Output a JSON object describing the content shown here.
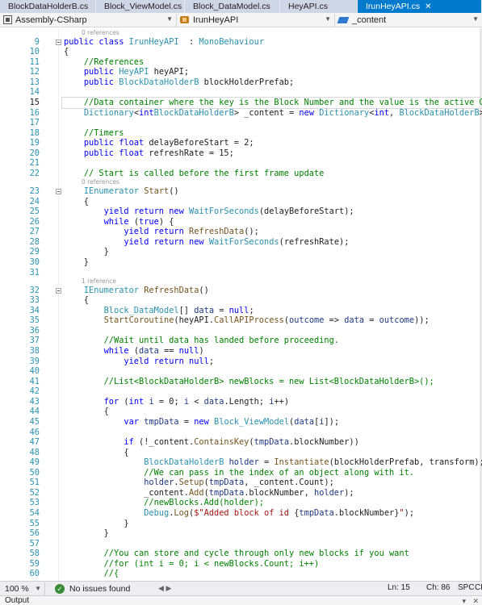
{
  "tabs": [
    {
      "label": "BlockDataHolderB.cs",
      "active": false
    },
    {
      "label": "Block_ViewModel.cs",
      "active": false
    },
    {
      "label": "Block_DataModel.cs",
      "active": false
    },
    {
      "label": "HeyAPI.cs",
      "active": false
    },
    {
      "label": "IrunHeyAPI.cs",
      "active": true
    }
  ],
  "nav": {
    "project": "Assembly-CSharp",
    "class_name": "IrunHeyAPI",
    "member": "_content"
  },
  "editor": {
    "current_line": 15,
    "lines": [
      {
        "n": "",
        "lens": "0 references"
      },
      {
        "n": "9",
        "fold": true,
        "tokens": [
          [
            "kw",
            "public "
          ],
          [
            "kw",
            "class "
          ],
          [
            "ty",
            "IrunHeyAPI"
          ],
          [
            "",
            "  : "
          ],
          [
            "ty",
            "MonoBehaviour"
          ]
        ]
      },
      {
        "n": "10",
        "tokens": [
          [
            "",
            "{"
          ]
        ]
      },
      {
        "n": "11",
        "tokens": [
          [
            "",
            "    "
          ],
          [
            "cm",
            "//References"
          ]
        ]
      },
      {
        "n": "12",
        "tokens": [
          [
            "",
            "    "
          ],
          [
            "kw",
            "public "
          ],
          [
            "ty",
            "HeyAPI"
          ],
          [
            "",
            " heyAPI;"
          ]
        ]
      },
      {
        "n": "13",
        "tokens": [
          [
            "",
            "    "
          ],
          [
            "kw",
            "public "
          ],
          [
            "ty",
            "BlockDataHolderB"
          ],
          [
            "",
            " blockHolderPrefab;"
          ]
        ]
      },
      {
        "n": "14",
        "tokens": []
      },
      {
        "n": "15",
        "tokens": [
          [
            "",
            "    "
          ],
          [
            "cm",
            "//Data container where the key is the Block Number and the value is the active GameObject"
          ]
        ]
      },
      {
        "n": "16",
        "tokens": [
          [
            "",
            "    "
          ],
          [
            "ty",
            "Dictionary"
          ],
          [
            "",
            "<"
          ],
          [
            "kw",
            "int"
          ],
          [
            ", ",
            ""
          ],
          [
            "ty",
            "BlockDataHolderB"
          ],
          [
            "",
            "> _content = "
          ],
          [
            "kw",
            "new "
          ],
          [
            "ty",
            "Dictionary"
          ],
          [
            "",
            "<"
          ],
          [
            "kw",
            "int"
          ],
          [
            "",
            ", "
          ],
          [
            "ty",
            "BlockDataHolderB"
          ],
          [
            "",
            ">();"
          ]
        ]
      },
      {
        "n": "17",
        "tokens": []
      },
      {
        "n": "18",
        "tokens": [
          [
            "",
            "    "
          ],
          [
            "cm",
            "//Timers"
          ]
        ]
      },
      {
        "n": "19",
        "tokens": [
          [
            "",
            "    "
          ],
          [
            "kw",
            "public "
          ],
          [
            "kw",
            "float "
          ],
          [
            "",
            "delayBeforeStart = 2;"
          ]
        ]
      },
      {
        "n": "20",
        "tokens": [
          [
            "",
            "    "
          ],
          [
            "kw",
            "public "
          ],
          [
            "kw",
            "float "
          ],
          [
            "",
            "refreshRate = 15;"
          ]
        ]
      },
      {
        "n": "21",
        "tokens": []
      },
      {
        "n": "22",
        "tokens": [
          [
            "",
            "    "
          ],
          [
            "cm",
            "// Start is called before the first frame update"
          ]
        ]
      },
      {
        "n": "",
        "lens": "0 references"
      },
      {
        "n": "23",
        "fold": true,
        "tokens": [
          [
            "",
            "    "
          ],
          [
            "ty",
            "IEnumerator"
          ],
          [
            "",
            " "
          ],
          [
            "mt",
            "Start"
          ],
          [
            "",
            "()"
          ]
        ]
      },
      {
        "n": "24",
        "tokens": [
          [
            "",
            "    {"
          ]
        ]
      },
      {
        "n": "25",
        "tokens": [
          [
            "",
            "        "
          ],
          [
            "kw",
            "yield "
          ],
          [
            "kw",
            "return "
          ],
          [
            "kw",
            "new "
          ],
          [
            "ty",
            "WaitForSeconds"
          ],
          [
            "",
            "(delayBeforeStart);"
          ]
        ]
      },
      {
        "n": "26",
        "tokens": [
          [
            "",
            "        "
          ],
          [
            "kw",
            "while "
          ],
          [
            "",
            "("
          ],
          [
            "kw",
            "true"
          ],
          [
            "",
            ") {"
          ]
        ]
      },
      {
        "n": "27",
        "tokens": [
          [
            "",
            "            "
          ],
          [
            "kw",
            "yield "
          ],
          [
            "kw",
            "return "
          ],
          [
            "mt",
            "RefreshData"
          ],
          [
            "",
            "();"
          ]
        ]
      },
      {
        "n": "28",
        "tokens": [
          [
            "",
            "            "
          ],
          [
            "kw",
            "yield "
          ],
          [
            "kw",
            "return "
          ],
          [
            "kw",
            "new "
          ],
          [
            "ty",
            "WaitForSeconds"
          ],
          [
            "",
            "(refreshRate);"
          ]
        ]
      },
      {
        "n": "29",
        "tokens": [
          [
            "",
            "        }"
          ]
        ]
      },
      {
        "n": "30",
        "tokens": [
          [
            "",
            "    }"
          ]
        ]
      },
      {
        "n": "31",
        "tokens": []
      },
      {
        "n": "",
        "lens": "1 reference"
      },
      {
        "n": "32",
        "fold": true,
        "tokens": [
          [
            "",
            "    "
          ],
          [
            "ty",
            "IEnumerator"
          ],
          [
            "",
            " "
          ],
          [
            "mt",
            "RefreshData"
          ],
          [
            "",
            "()"
          ]
        ]
      },
      {
        "n": "33",
        "tokens": [
          [
            "",
            "    {"
          ]
        ]
      },
      {
        "n": "34",
        "tokens": [
          [
            "",
            "        "
          ],
          [
            "ty",
            "Block_DataModel"
          ],
          [
            "",
            "[] "
          ],
          [
            "vl",
            "data"
          ],
          [
            "",
            " = "
          ],
          [
            "kw",
            "null"
          ],
          [
            "",
            ";"
          ]
        ]
      },
      {
        "n": "35",
        "tokens": [
          [
            "",
            "        "
          ],
          [
            "mt",
            "StartCoroutine"
          ],
          [
            "",
            "(heyAPI."
          ],
          [
            "mt",
            "CallAPIProcess"
          ],
          [
            "",
            "("
          ],
          [
            "vl",
            "outcome"
          ],
          [
            "",
            " => "
          ],
          [
            "vl",
            "data"
          ],
          [
            "",
            " = "
          ],
          [
            "vl",
            "outcome"
          ],
          [
            "",
            "));"
          ]
        ]
      },
      {
        "n": "36",
        "tokens": []
      },
      {
        "n": "37",
        "tokens": [
          [
            "",
            "        "
          ],
          [
            "cm",
            "//Wait until data has landed before proceeding."
          ]
        ]
      },
      {
        "n": "38",
        "tokens": [
          [
            "",
            "        "
          ],
          [
            "kw",
            "while "
          ],
          [
            "",
            "("
          ],
          [
            "vl",
            "data"
          ],
          [
            "",
            " == "
          ],
          [
            "kw",
            "null"
          ],
          [
            "",
            ")"
          ]
        ]
      },
      {
        "n": "39",
        "tokens": [
          [
            "",
            "            "
          ],
          [
            "kw",
            "yield "
          ],
          [
            "kw",
            "return "
          ],
          [
            "kw",
            "null"
          ],
          [
            "",
            ";"
          ]
        ]
      },
      {
        "n": "40",
        "tokens": []
      },
      {
        "n": "41",
        "tokens": [
          [
            "",
            "        "
          ],
          [
            "cm",
            "//List<BlockDataHolderB> newBlocks = new List<BlockDataHolderB>();"
          ]
        ]
      },
      {
        "n": "42",
        "tokens": []
      },
      {
        "n": "43",
        "tokens": [
          [
            "",
            "        "
          ],
          [
            "kw",
            "for "
          ],
          [
            "",
            "("
          ],
          [
            "kw",
            "int "
          ],
          [
            "vl",
            "i"
          ],
          [
            "",
            " = 0; "
          ],
          [
            "vl",
            "i"
          ],
          [
            "",
            " < "
          ],
          [
            "vl",
            "data"
          ],
          [
            "",
            ".Length; "
          ],
          [
            "vl",
            "i"
          ],
          [
            "",
            "++)"
          ]
        ]
      },
      {
        "n": "44",
        "tokens": [
          [
            "",
            "        {"
          ]
        ]
      },
      {
        "n": "45",
        "tokens": [
          [
            "",
            "            "
          ],
          [
            "kw",
            "var "
          ],
          [
            "vl",
            "tmpData"
          ],
          [
            "",
            " = "
          ],
          [
            "kw",
            "new "
          ],
          [
            "ty",
            "Block_ViewModel"
          ],
          [
            "",
            "("
          ],
          [
            "vl",
            "data"
          ],
          [
            "",
            "["
          ],
          [
            "vl",
            "i"
          ],
          [
            "",
            "]);"
          ]
        ]
      },
      {
        "n": "46",
        "tokens": []
      },
      {
        "n": "47",
        "tokens": [
          [
            "",
            "            "
          ],
          [
            "kw",
            "if "
          ],
          [
            "",
            "(!_content."
          ],
          [
            "mt",
            "ContainsKey"
          ],
          [
            "",
            "("
          ],
          [
            "vl",
            "tmpData"
          ],
          [
            "",
            ".blockNumber))"
          ]
        ]
      },
      {
        "n": "48",
        "tokens": [
          [
            "",
            "            {"
          ]
        ]
      },
      {
        "n": "49",
        "tokens": [
          [
            "",
            "                "
          ],
          [
            "ty",
            "BlockDataHolderB"
          ],
          [
            "",
            " "
          ],
          [
            "vl",
            "holder"
          ],
          [
            "",
            " = "
          ],
          [
            "mt",
            "Instantiate"
          ],
          [
            "",
            "(blockHolderPrefab, transform);"
          ]
        ]
      },
      {
        "n": "50",
        "tokens": [
          [
            "",
            "                "
          ],
          [
            "cm",
            "//We can pass in the index of an object along with it."
          ]
        ]
      },
      {
        "n": "51",
        "tokens": [
          [
            "",
            "                "
          ],
          [
            "vl",
            "holder"
          ],
          [
            "",
            "."
          ],
          [
            "mt",
            "Setup"
          ],
          [
            "",
            "("
          ],
          [
            "vl",
            "tmpData"
          ],
          [
            "",
            ", _content.Count);"
          ]
        ]
      },
      {
        "n": "52",
        "tokens": [
          [
            "",
            "                _content."
          ],
          [
            "mt",
            "Add"
          ],
          [
            "",
            "("
          ],
          [
            "vl",
            "tmpData"
          ],
          [
            "",
            ".blockNumber, "
          ],
          [
            "vl",
            "holder"
          ],
          [
            "",
            ");"
          ]
        ]
      },
      {
        "n": "53",
        "tokens": [
          [
            "",
            "                "
          ],
          [
            "cm",
            "//newBlocks.Add(holder);"
          ]
        ]
      },
      {
        "n": "54",
        "tokens": [
          [
            "",
            "                "
          ],
          [
            "ty",
            "Debug"
          ],
          [
            "",
            "."
          ],
          [
            "mt",
            "Log"
          ],
          [
            "",
            "("
          ],
          [
            "st",
            "$\"Added block of id "
          ],
          [
            "",
            "{"
          ],
          [
            "vl",
            "tmpData"
          ],
          [
            "",
            ".blockNumber}"
          ],
          [
            "st",
            "\""
          ],
          [
            "",
            ");"
          ]
        ]
      },
      {
        "n": "55",
        "tokens": [
          [
            "",
            "            }"
          ]
        ]
      },
      {
        "n": "56",
        "tokens": [
          [
            "",
            "        }"
          ]
        ]
      },
      {
        "n": "57",
        "tokens": []
      },
      {
        "n": "58",
        "tokens": [
          [
            "",
            "        "
          ],
          [
            "cm",
            "//You can store and cycle through only new blocks if you want"
          ]
        ]
      },
      {
        "n": "59",
        "tokens": [
          [
            "",
            "        "
          ],
          [
            "cm",
            "//for (int i = 0; i < newBlocks.Count; i++)"
          ]
        ]
      },
      {
        "n": "60",
        "tokens": [
          [
            "",
            "        "
          ],
          [
            "cm",
            "//{"
          ]
        ]
      }
    ]
  },
  "status": {
    "zoom": "100 %",
    "issues": "No issues found",
    "line": "Ln: 15",
    "col": "Ch: 86",
    "mode": "SPC",
    "eol": "CR"
  },
  "output_panel": {
    "title": "Output"
  },
  "colors": {
    "accent": "#007acc",
    "keyword": "#0000ff",
    "type": "#2b91af",
    "comment": "#008000",
    "string": "#a31515"
  }
}
